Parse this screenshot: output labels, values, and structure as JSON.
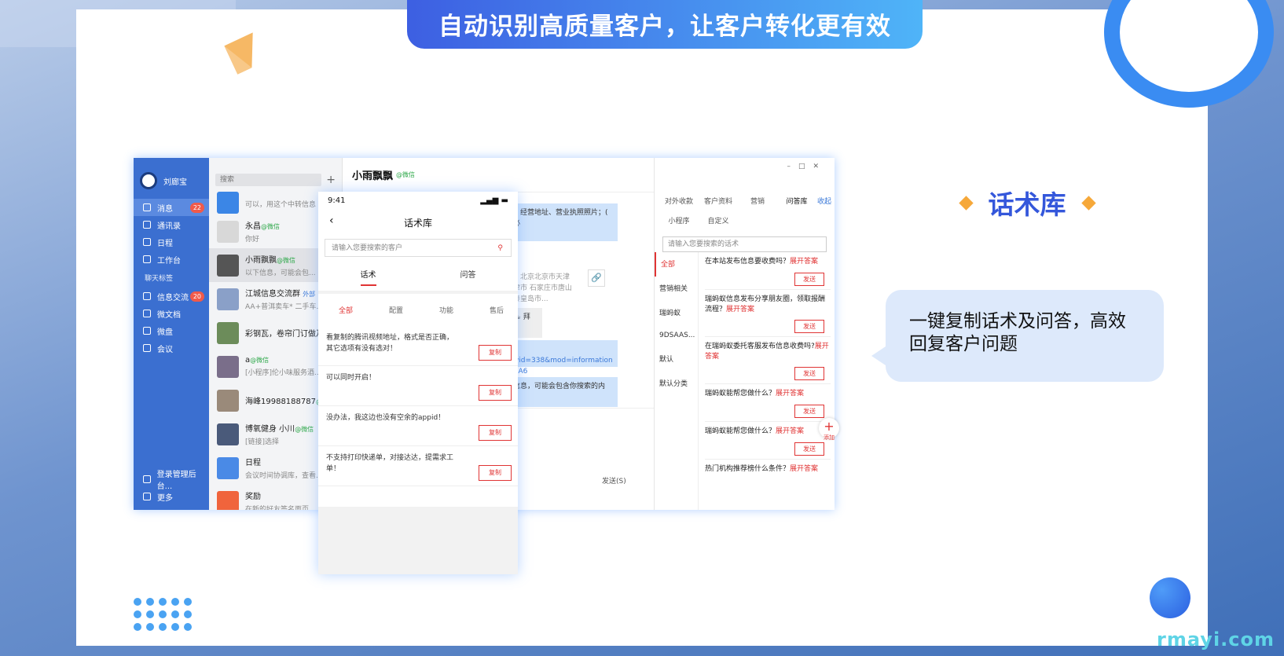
{
  "banner": "自动识别高质量客户，让客户转化更有效",
  "feature": {
    "title": "话术库",
    "desc": "一键复制话术及问答，高效回复客户问题"
  },
  "watermark": "rmayi.com",
  "app": {
    "sidebar": {
      "user": "刘廊宝",
      "items": [
        {
          "label": "消息",
          "badge": "22"
        },
        {
          "label": "通讯录"
        },
        {
          "label": "日程"
        },
        {
          "label": "工作台"
        }
      ],
      "section": "聊天标签",
      "items2": [
        {
          "label": "信息交流",
          "badge": "20"
        },
        {
          "label": "微文档"
        },
        {
          "label": "微盘"
        },
        {
          "label": "会议"
        }
      ],
      "bottom": [
        "登录管理后台...",
        "更多"
      ]
    },
    "contacts": {
      "search_placeholder": "搜索",
      "items": [
        {
          "name": "",
          "sub": "可以，用这个中转信息"
        },
        {
          "name": "永昌",
          "tag": "@微信",
          "sub": "你好"
        },
        {
          "name": "小雨飘飘",
          "tag": "@微信",
          "sub": "以下信息，可能会包..."
        },
        {
          "name": "江城信息交流群",
          "tag": "外部",
          "sub": "AA+普洱卖车* 二手车..."
        },
        {
          "name": "彩钢瓦，卷帘门订做及...",
          "sub": ""
        },
        {
          "name": "a",
          "tag": "@微信",
          "sub": "[小程序]伦小味服务酒..."
        },
        {
          "name": "海峰19988188787",
          "tag": "@微",
          "sub": ""
        },
        {
          "name": "博氧健身   小川",
          "tag": "@微信",
          "sub": "[链接]选择"
        },
        {
          "name": "日程",
          "sub": "会议时间协调库，查看..."
        },
        {
          "name": "奖励",
          "sub": "在新的好友签名面页..."
        }
      ]
    },
    "chat": {
      "title": "小雨飘飘",
      "tag": "@微信",
      "msg1": "止、经营地址、营业执照照片；( 不必",
      "msg_addr": "如：北京北京市天津天津市 石家庄市唐山市秦皇岛市...",
      "msg2": "☕ ☕ 拜托",
      "msg_link": "p?cityid=338&mod=information D%A6",
      "msg3": "下信息，可能会包含你搜索的内容。",
      "send": "发送(S)"
    },
    "right": {
      "tabs": [
        "对外收款",
        "客户资料",
        "营销",
        "问答库",
        "小程序",
        "自定义"
      ],
      "collapse": "收起",
      "search_placeholder": "请输入您要搜索的话术",
      "cats": [
        "全部",
        "营销相关",
        "瑞蚂蚁",
        "9DSAAS...",
        "默认",
        "默认分类"
      ],
      "questions": [
        {
          "q": "在本站发布信息要收费吗？",
          "ex": "展开答案"
        },
        {
          "q": "瑞蚂蚁信息发布分享朋友圈，领取报酬流程？",
          "ex": "展开答案"
        },
        {
          "q": "在瑞蚂蚁委托客服发布信息收费吗?",
          "ex": "展开答案"
        },
        {
          "q": "瑞蚂蚁能帮您做什么？",
          "ex": "展开答案"
        },
        {
          "q": "瑞蚂蚁能帮您做什么？",
          "ex": "展开答案"
        },
        {
          "q": "热门机构推荐榜什么条件？",
          "ex": "展开答案"
        }
      ],
      "send_label": "发送",
      "add_label": "添加"
    }
  },
  "phone": {
    "time": "9:41",
    "title": "话术库",
    "search_placeholder": "请输入您要搜索的客户",
    "tabs": [
      "话术",
      "问答"
    ],
    "cats": [
      "全部",
      "配置",
      "功能",
      "售后"
    ],
    "items": [
      "看复制的腾讯视频地址，格式是否正确，其它选项有没有选对！",
      "可以同时开启！",
      "没办法，我这边也没有空余的appid！",
      "不支持打印快递单，对接达达，提需求工单！"
    ],
    "copy_label": "复制"
  }
}
